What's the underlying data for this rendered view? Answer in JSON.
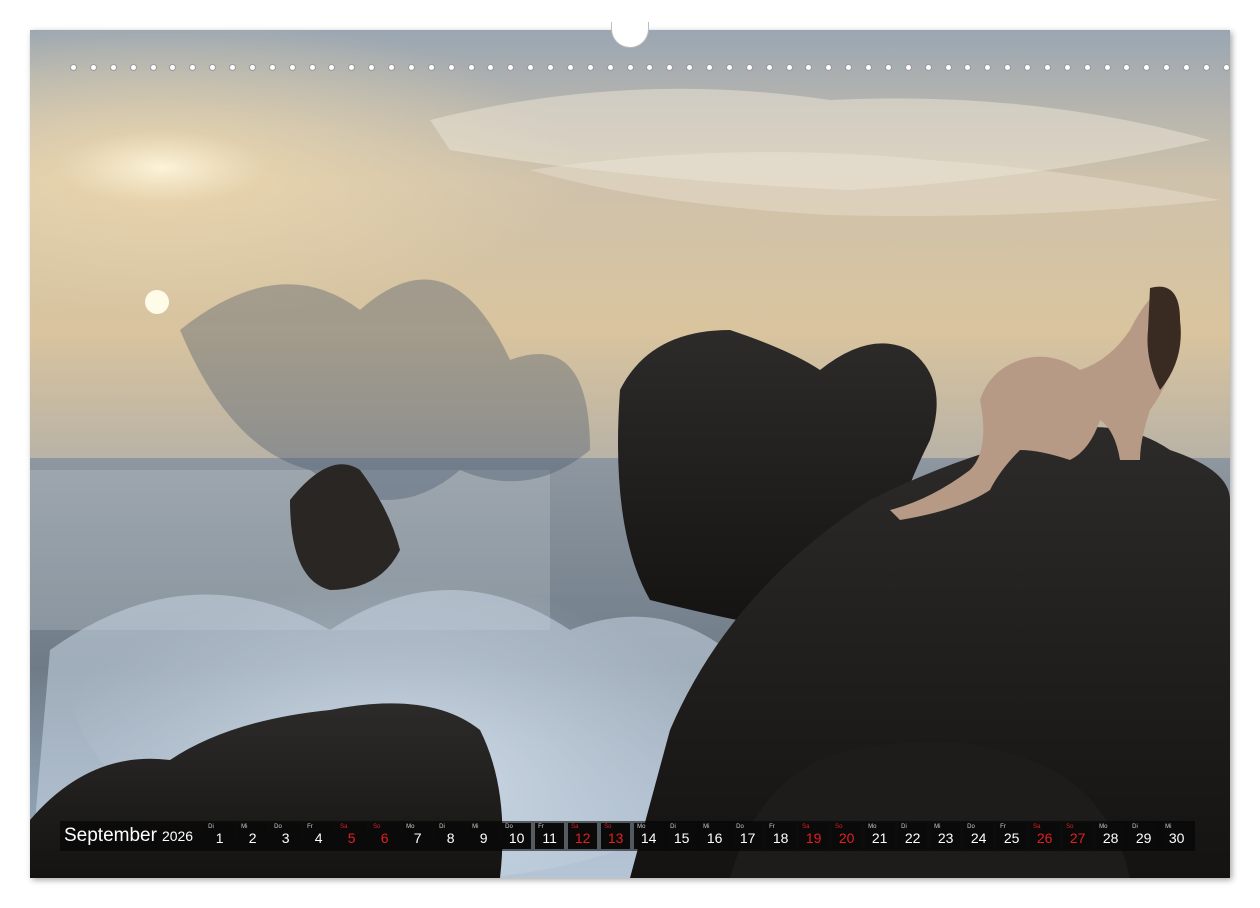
{
  "calendar": {
    "month": "September",
    "year": "2026",
    "days": [
      {
        "wd": "Di",
        "num": "1",
        "weekend": false
      },
      {
        "wd": "Mi",
        "num": "2",
        "weekend": false
      },
      {
        "wd": "Do",
        "num": "3",
        "weekend": false
      },
      {
        "wd": "Fr",
        "num": "4",
        "weekend": false
      },
      {
        "wd": "Sa",
        "num": "5",
        "weekend": true
      },
      {
        "wd": "So",
        "num": "6",
        "weekend": true
      },
      {
        "wd": "Mo",
        "num": "7",
        "weekend": false
      },
      {
        "wd": "Di",
        "num": "8",
        "weekend": false
      },
      {
        "wd": "Mi",
        "num": "9",
        "weekend": false
      },
      {
        "wd": "Do",
        "num": "10",
        "weekend": false
      },
      {
        "wd": "Fr",
        "num": "11",
        "weekend": false
      },
      {
        "wd": "Sa",
        "num": "12",
        "weekend": true
      },
      {
        "wd": "So",
        "num": "13",
        "weekend": true
      },
      {
        "wd": "Mo",
        "num": "14",
        "weekend": false
      },
      {
        "wd": "Di",
        "num": "15",
        "weekend": false
      },
      {
        "wd": "Mi",
        "num": "16",
        "weekend": false
      },
      {
        "wd": "Do",
        "num": "17",
        "weekend": false
      },
      {
        "wd": "Fr",
        "num": "18",
        "weekend": false
      },
      {
        "wd": "Sa",
        "num": "19",
        "weekend": true
      },
      {
        "wd": "So",
        "num": "20",
        "weekend": true
      },
      {
        "wd": "Mo",
        "num": "21",
        "weekend": false
      },
      {
        "wd": "Di",
        "num": "22",
        "weekend": false
      },
      {
        "wd": "Mi",
        "num": "23",
        "weekend": false
      },
      {
        "wd": "Do",
        "num": "24",
        "weekend": false
      },
      {
        "wd": "Fr",
        "num": "25",
        "weekend": false
      },
      {
        "wd": "Sa",
        "num": "26",
        "weekend": true
      },
      {
        "wd": "So",
        "num": "27",
        "weekend": true
      },
      {
        "wd": "Mo",
        "num": "28",
        "weekend": false
      },
      {
        "wd": "Di",
        "num": "29",
        "weekend": false
      },
      {
        "wd": "Mi",
        "num": "30",
        "weekend": false
      }
    ]
  },
  "colors": {
    "weekend": "#e02020",
    "cell_bg": "#0a0a0a",
    "text": "#ffffff"
  },
  "binding": {
    "hole_count": 60
  }
}
